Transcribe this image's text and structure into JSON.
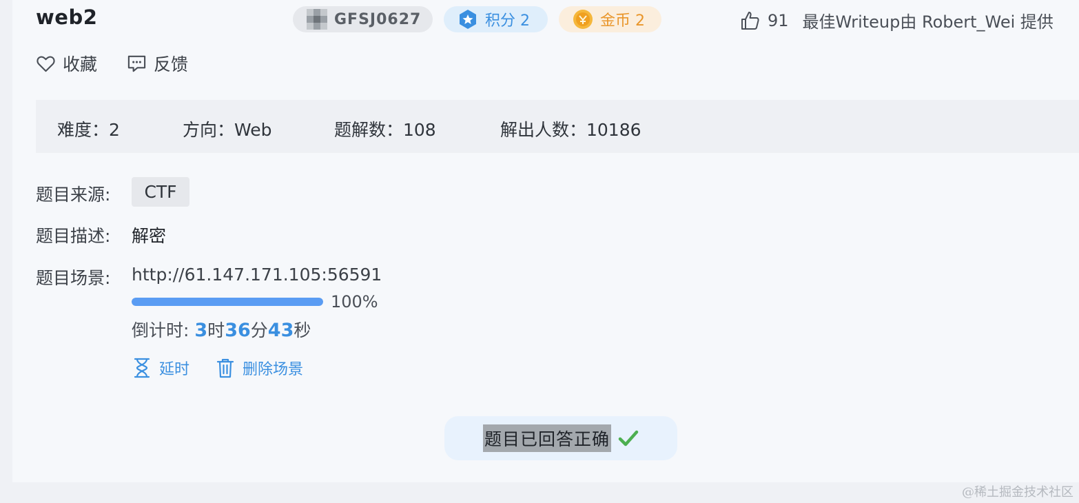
{
  "challenge": {
    "title": "web2",
    "id_label": "GFSJ0627",
    "score_label": "积分 2",
    "coin_label": "金币 2"
  },
  "writeup": {
    "likes": "91",
    "text": "最佳Writeup由 Robert_Wei 提供"
  },
  "actions": {
    "favorite": "收藏",
    "feedback": "反馈"
  },
  "stats": {
    "difficulty": "难度：2",
    "direction": "方向：Web",
    "writeups": "题解数：108",
    "solvers": "解出人数：10186"
  },
  "info": {
    "source_label": "题目来源:",
    "source_value": "CTF",
    "desc_label": "题目描述:",
    "desc_value": "解密",
    "scene_label": "题目场景:",
    "scene_url": "http://61.147.171.105:56591"
  },
  "progress": {
    "value": 1.0,
    "label": "100%"
  },
  "countdown": {
    "prefix": "倒计时: ",
    "hours": "3",
    "hours_unit": "时",
    "minutes": "36",
    "minutes_unit": "分",
    "seconds": "43",
    "seconds_unit": "秒"
  },
  "scene_actions": {
    "delay": "延时",
    "delete": "删除场景"
  },
  "status": {
    "answered": "题目已回答正确"
  },
  "watermark": "@稀土掘金技术社区",
  "colors": {
    "accent": "#3a8fe0",
    "coin": "#e9962b",
    "success": "#4caf50",
    "progress": "#5a9cf3"
  },
  "icons": {
    "id_badge": "avatar-icon",
    "score": "star-hexagon-icon",
    "coin": "coin-icon",
    "likes": "thumbs-up-icon",
    "favorite": "heart-icon",
    "feedback": "feedback-icon",
    "delay": "hourglass-icon",
    "delete": "trash-icon",
    "answered": "checkmark-icon"
  }
}
